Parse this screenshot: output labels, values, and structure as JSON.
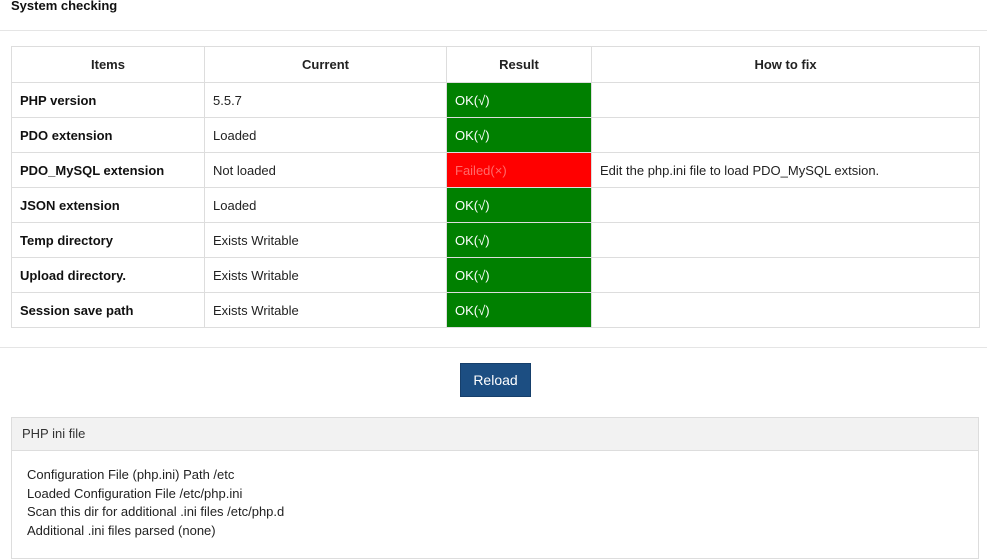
{
  "page": {
    "title": "System checking"
  },
  "table": {
    "headers": [
      "Items",
      "Current",
      "Result",
      "How to fix"
    ],
    "rows": [
      {
        "item": "PHP version",
        "current": "5.5.7",
        "result": "OK(√)",
        "status": "ok",
        "fix": ""
      },
      {
        "item": "PDO extension",
        "current": "Loaded",
        "result": "OK(√)",
        "status": "ok",
        "fix": ""
      },
      {
        "item": "PDO_MySQL extension",
        "current": "Not loaded",
        "result": "Failed(×)",
        "status": "fail",
        "fix": "Edit the php.ini file to load PDO_MySQL extsion."
      },
      {
        "item": "JSON extension",
        "current": "Loaded",
        "result": "OK(√)",
        "status": "ok",
        "fix": ""
      },
      {
        "item": "Temp directory",
        "current": "Exists Writable",
        "result": "OK(√)",
        "status": "ok",
        "fix": ""
      },
      {
        "item": "Upload directory.",
        "current": "Exists Writable",
        "result": "OK(√)",
        "status": "ok",
        "fix": ""
      },
      {
        "item": "Session save path",
        "current": "Exists Writable",
        "result": "OK(√)",
        "status": "ok",
        "fix": ""
      }
    ]
  },
  "actions": {
    "reload_label": "Reload"
  },
  "ini_panel": {
    "heading": "PHP ini file",
    "lines": [
      "Configuration File (php.ini) Path /etc",
      "Loaded Configuration File /etc/php.ini",
      "Scan this dir for additional .ini files /etc/php.d",
      "Additional .ini files parsed (none)"
    ]
  },
  "colors": {
    "ok": "#008000",
    "fail": "#ff0000",
    "button": "#1c4e82"
  }
}
